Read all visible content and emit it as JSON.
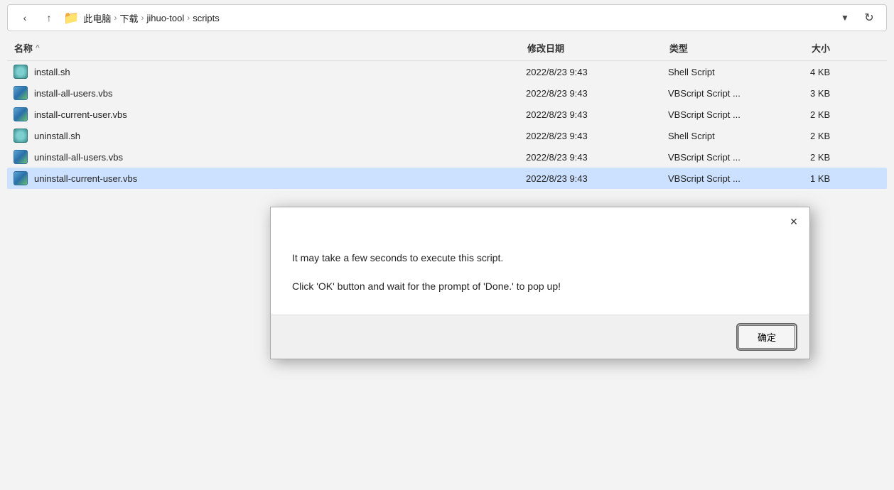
{
  "addressBar": {
    "backLabel": "‹",
    "upLabel": "↑",
    "folderIcon": "📁",
    "breadcrumbs": [
      "此电脑",
      "下载",
      "jihuo-tool",
      "scripts"
    ],
    "dropdownLabel": "▾",
    "refreshLabel": "↻"
  },
  "fileList": {
    "columns": {
      "name": "名称",
      "nameSort": "^",
      "modified": "修改日期",
      "type": "类型",
      "size": "大小"
    },
    "files": [
      {
        "id": "install-sh",
        "name": "install.sh",
        "iconType": "sh",
        "modified": "2022/8/23 9:43",
        "type": "Shell Script",
        "size": "4 KB",
        "selected": false
      },
      {
        "id": "install-all-users",
        "name": "install-all-users.vbs",
        "iconType": "vbs",
        "modified": "2022/8/23 9:43",
        "type": "VBScript Script ...",
        "size": "3 KB",
        "selected": false
      },
      {
        "id": "install-current-user",
        "name": "install-current-user.vbs",
        "iconType": "vbs",
        "modified": "2022/8/23 9:43",
        "type": "VBScript Script ...",
        "size": "2 KB",
        "selected": false
      },
      {
        "id": "uninstall-sh",
        "name": "uninstall.sh",
        "iconType": "sh",
        "modified": "2022/8/23 9:43",
        "type": "Shell Script",
        "size": "2 KB",
        "selected": false
      },
      {
        "id": "uninstall-all-users",
        "name": "uninstall-all-users.vbs",
        "iconType": "vbs",
        "modified": "2022/8/23 9:43",
        "type": "VBScript Script ...",
        "size": "2 KB",
        "selected": false
      },
      {
        "id": "uninstall-current-user",
        "name": "uninstall-current-user.vbs",
        "iconType": "vbs",
        "modified": "2022/8/23 9:43",
        "type": "VBScript Script ...",
        "size": "1 KB",
        "selected": true
      }
    ]
  },
  "dialog": {
    "line1": "It may take a few seconds to execute this script.",
    "line2": "Click 'OK' button and wait for the prompt of 'Done.' to pop up!",
    "okLabel": "确定",
    "closeLabel": "×"
  }
}
